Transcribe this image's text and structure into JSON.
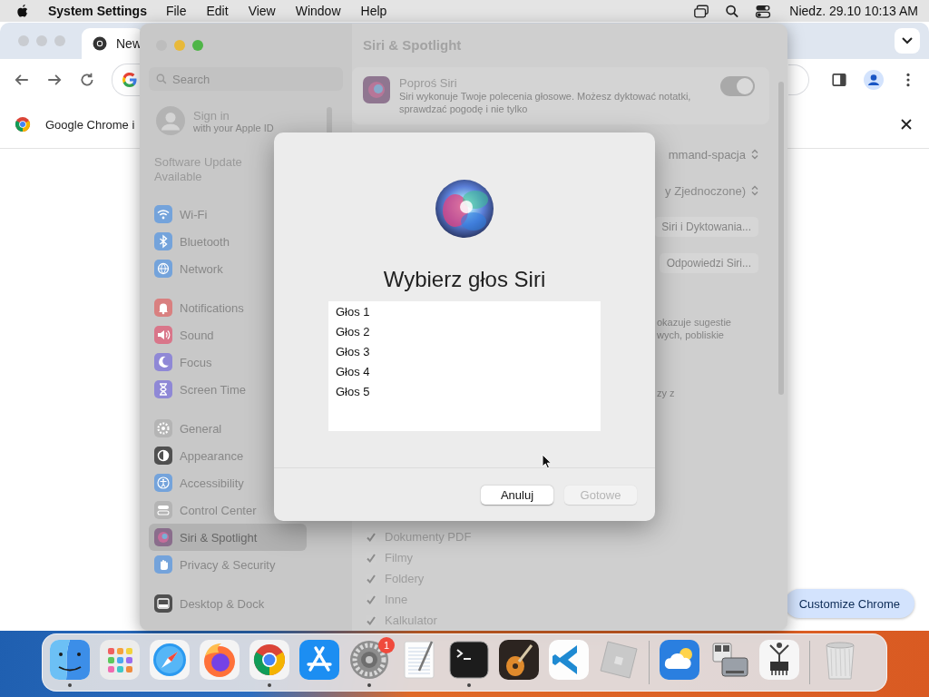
{
  "menu_bar": {
    "app": "System Settings",
    "menus": [
      "File",
      "Edit",
      "View",
      "Window",
      "Help"
    ],
    "clock": "Niedz. 29.10  10:13 AM"
  },
  "chrome": {
    "tab": "New",
    "infobar": "Google Chrome i",
    "customize": "Customize Chrome"
  },
  "settings": {
    "title": "Siri & Spotlight",
    "search": {
      "placeholder": "Search"
    },
    "account": {
      "title": "Sign in",
      "subtitle": "with your Apple ID"
    },
    "update": "Software Update Available",
    "groups": [
      [
        {
          "label": "Wi-Fi",
          "kind": "wifi",
          "color": "#74a3db",
          "selected": false
        },
        {
          "label": "Bluetooth",
          "kind": "bluetooth",
          "color": "#74a3db",
          "selected": false
        },
        {
          "label": "Network",
          "kind": "globe",
          "color": "#74a3db",
          "selected": false
        }
      ],
      [
        {
          "label": "Notifications",
          "kind": "bell",
          "color": "#d98080",
          "selected": false
        },
        {
          "label": "Sound",
          "kind": "speaker",
          "color": "#d9768a",
          "selected": false
        },
        {
          "label": "Focus",
          "kind": "moon",
          "color": "#8f88d6",
          "selected": false
        },
        {
          "label": "Screen Time",
          "kind": "hourglass",
          "color": "#8f88d6",
          "selected": false
        }
      ],
      [
        {
          "label": "General",
          "kind": "gear",
          "color": "#b4b4b4",
          "selected": false
        },
        {
          "label": "Appearance",
          "kind": "contrast",
          "color": "#505050",
          "selected": false
        },
        {
          "label": "Accessibility",
          "kind": "accessibility",
          "color": "#74a3db",
          "selected": false
        },
        {
          "label": "Control Center",
          "kind": "toggles",
          "color": "#b4b4b4",
          "selected": false
        },
        {
          "label": "Siri & Spotlight",
          "kind": "siri",
          "color": "#8a6d8c",
          "selected": true
        },
        {
          "label": "Privacy & Security",
          "kind": "hand",
          "color": "#74a3db",
          "selected": false
        }
      ],
      [
        {
          "label": "Desktop & Dock",
          "kind": "dock",
          "color": "#505050",
          "selected": false
        }
      ]
    ],
    "siri_card": {
      "title": "Poproś Siri",
      "description": "Siri wykonuje Twoje polecenia głosowe. Możesz dyktować notatki, sprawdzać pogodę i nie tylko",
      "on": true
    },
    "rows": [
      {
        "kind": "popup",
        "value": "mmand-spacja"
      },
      {
        "kind": "popup",
        "value": "y Zjednoczone)"
      },
      {
        "kind": "button",
        "label": "Siri i Dyktowania..."
      },
      {
        "kind": "button",
        "label": "Odpowiedzi Siri..."
      },
      {
        "kind": "text",
        "lines": [
          "okazuje sugestie",
          "wych, pobliskie"
        ]
      },
      {
        "kind": "text",
        "lines": [
          "zy z"
        ]
      }
    ],
    "categories": [
      {
        "label": "Dokumenty PDF",
        "checked": true
      },
      {
        "label": "Filmy",
        "checked": true
      },
      {
        "label": "Foldery",
        "checked": true
      },
      {
        "label": "Inne",
        "checked": true
      },
      {
        "label": "Kalkulator",
        "checked": true
      }
    ]
  },
  "dialog": {
    "title": "Wybierz głos Siri",
    "voices": [
      {
        "label": "Głos 1",
        "selected": false
      },
      {
        "label": "Głos 2",
        "selected": false
      },
      {
        "label": "Głos 3",
        "selected": false
      },
      {
        "label": "Głos 4",
        "selected": false
      },
      {
        "label": "Głos 5",
        "selected": false
      }
    ],
    "buttons": [
      {
        "label": "Anuluj",
        "disabled": false
      },
      {
        "label": "Gotowe",
        "disabled": true
      }
    ]
  },
  "dock": [
    {
      "kind": "finder",
      "running": true
    },
    {
      "kind": "launchpad",
      "running": false
    },
    {
      "kind": "safari",
      "running": false
    },
    {
      "kind": "firefox",
      "running": false
    },
    {
      "kind": "chrome",
      "running": true
    },
    {
      "kind": "appstore",
      "running": false
    },
    {
      "kind": "settings",
      "running": true,
      "badge": "1"
    },
    {
      "kind": "textedit",
      "running": false
    },
    {
      "kind": "terminal",
      "running": true
    },
    {
      "kind": "guitar",
      "running": false
    },
    {
      "kind": "vscode",
      "running": false
    },
    {
      "kind": "cube",
      "running": false
    },
    {
      "kind": "divider"
    },
    {
      "kind": "weather",
      "running": false
    },
    {
      "kind": "disk",
      "running": false
    },
    {
      "kind": "chip",
      "running": false
    },
    {
      "kind": "divider"
    },
    {
      "kind": "trash",
      "running": false
    }
  ]
}
